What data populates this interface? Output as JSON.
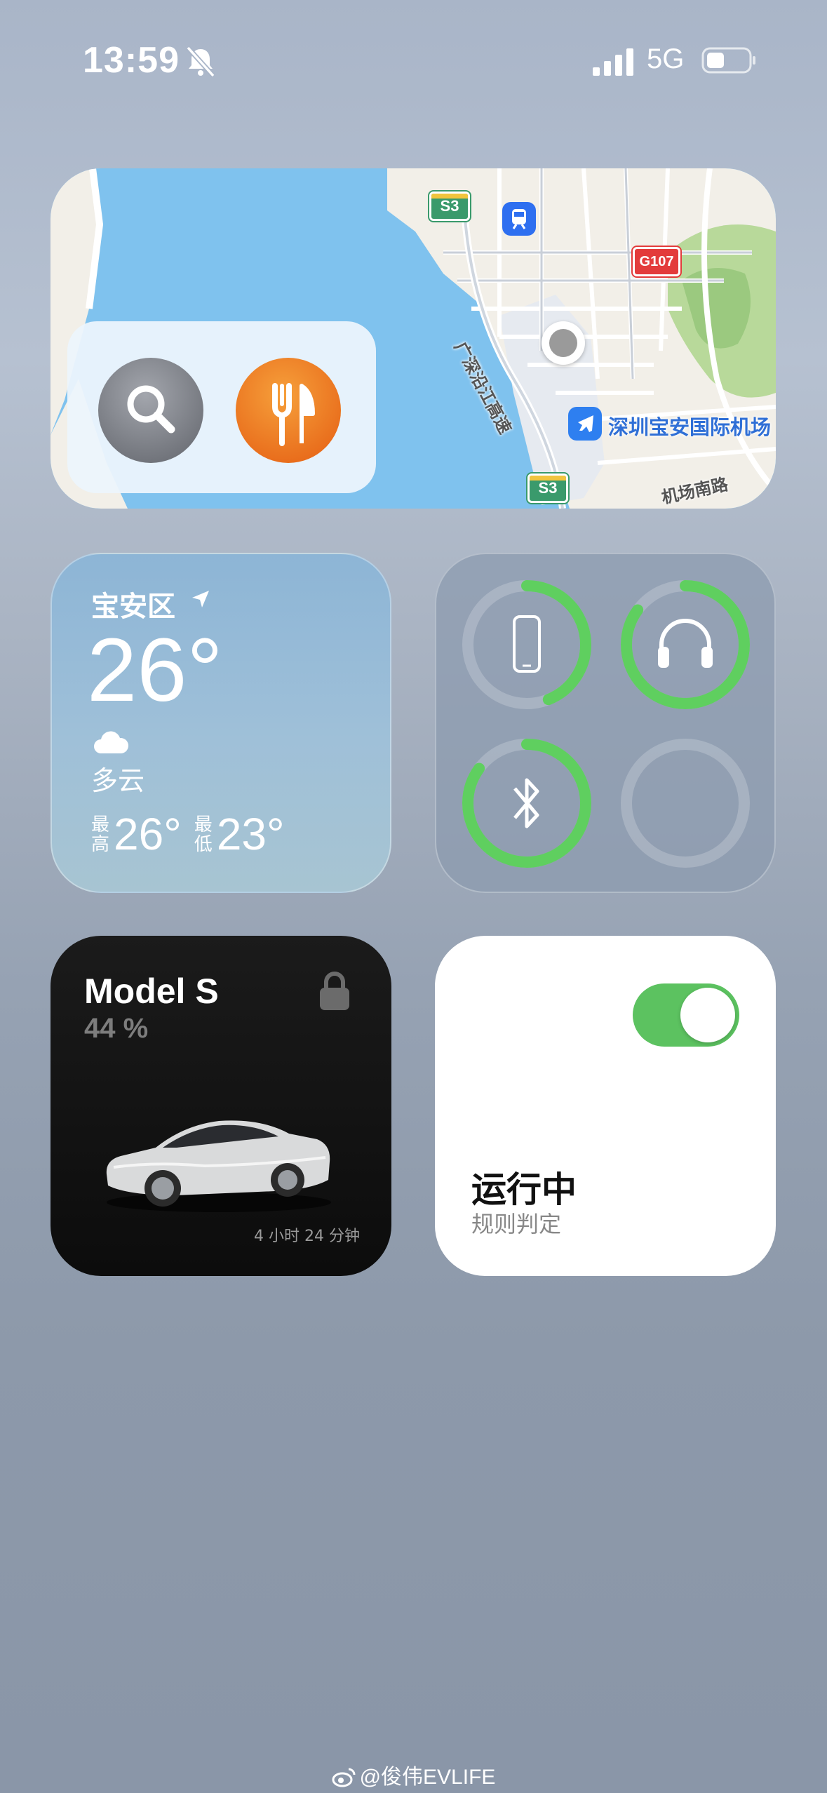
{
  "status_bar": {
    "time": "13:59",
    "network": "5G"
  },
  "map_widget": {
    "route_shields": [
      "S3",
      "G107",
      "S3"
    ],
    "airport_label": "深圳宝安国际机场",
    "road_labels": [
      "广深沿江高速",
      "机场南路"
    ]
  },
  "weather": {
    "city": "宝安区",
    "temperature": "26°",
    "condition": "多云",
    "high_tag": [
      "最",
      "高"
    ],
    "high": "26°",
    "low_tag": [
      "最",
      "低"
    ],
    "low": "23°"
  },
  "batteries": {
    "items": [
      {
        "device": "phone-icon",
        "level": 0.44,
        "color": "#5fcf5f"
      },
      {
        "device": "headphones-icon",
        "level": 0.85,
        "color": "#5fcf5f"
      },
      {
        "device": "bluetooth-icon",
        "level": 0.85,
        "color": "#5fcf5f"
      },
      {
        "device": "empty",
        "level": 0,
        "color": "#5fcf5f"
      }
    ]
  },
  "tesla": {
    "model": "Model S",
    "charge": "44 %",
    "time_remaining": "4 小时 24 分钟"
  },
  "running": {
    "title": "运行中",
    "subtitle": "规则判定",
    "toggle_on": true,
    "accent": "#5cc260"
  },
  "credit": "@俊伟EVLIFE"
}
